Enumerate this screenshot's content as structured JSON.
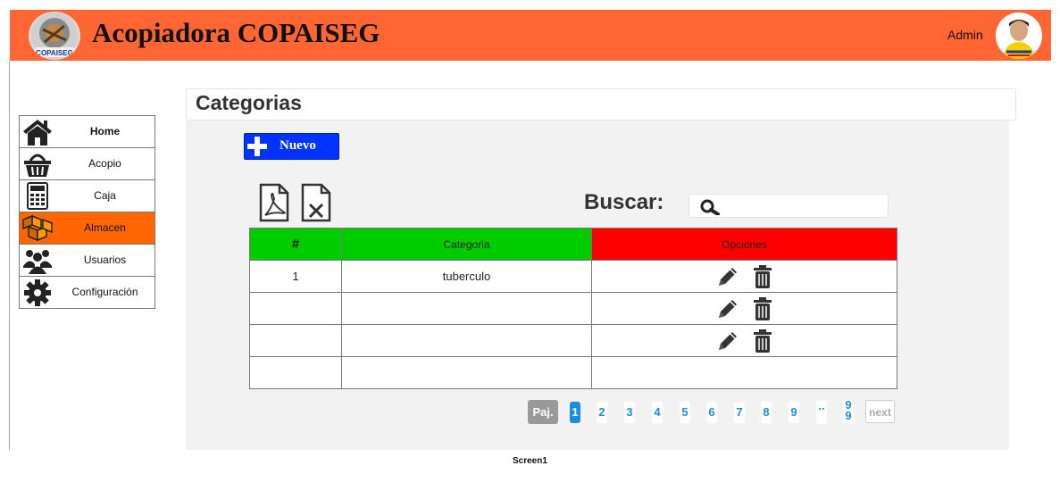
{
  "header": {
    "title": "Acopiadora COPAISEG",
    "logo_text": "COPAISEG",
    "user": "Admin"
  },
  "sidebar": {
    "items": [
      {
        "label": "Home",
        "icon": "home-icon"
      },
      {
        "label": "Acopio",
        "icon": "basket-icon"
      },
      {
        "label": "Caja",
        "icon": "calculator-icon"
      },
      {
        "label": "Almacen",
        "icon": "boxes-icon",
        "active": true
      },
      {
        "label": "Usuarios",
        "icon": "users-icon"
      },
      {
        "label": "Configuración",
        "icon": "gear-icon"
      }
    ]
  },
  "main": {
    "page_title": "Categorias",
    "new_button": "Nuevo",
    "search_label": "Buscar:",
    "search_value": "",
    "table": {
      "headers": [
        "#",
        "Categoria",
        "Opciones"
      ],
      "rows": [
        {
          "num": "1",
          "categoria": "tuberculo"
        },
        {
          "num": "",
          "categoria": ""
        },
        {
          "num": "",
          "categoria": ""
        },
        {
          "num": "",
          "categoria": ""
        }
      ]
    },
    "pagination": {
      "prev_label": "Paj.",
      "pages": [
        "1",
        "2",
        "3",
        "4",
        "5",
        "6",
        "7",
        "8",
        "9",
        "..",
        "99"
      ],
      "current": "1",
      "next_label": "next"
    }
  },
  "footer": {
    "caption": "Screen1"
  },
  "colors": {
    "header": "#ff6633",
    "active_menu": "#ff6600",
    "new_button": "#0033ff",
    "table_header_green": "#00cc00",
    "table_header_red": "#ff0000",
    "pagination_blue": "#1a8fe0"
  }
}
